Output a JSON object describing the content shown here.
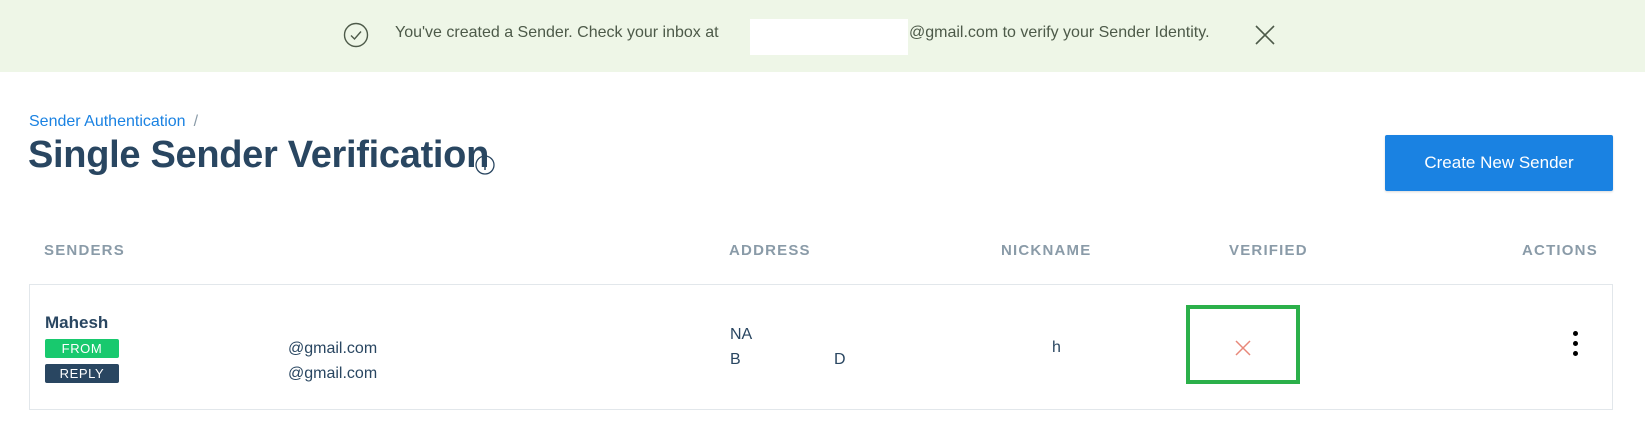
{
  "banner": {
    "message_part1": "You've created a Sender. Check your inbox at",
    "message_part2": "@gmail.com to verify your Sender Identity.",
    "icon": "check-circle-icon",
    "close_icon": "close-icon",
    "background": "#eef6e7"
  },
  "breadcrumb": {
    "parent": "Sender Authentication",
    "separator": "/"
  },
  "page": {
    "title": "Single Sender Verification",
    "info_icon": "info-icon"
  },
  "create_button": {
    "label": "Create New Sender",
    "color": "#1a82e2"
  },
  "table": {
    "headers": {
      "senders": "SENDERS",
      "address": "ADDRESS",
      "nickname": "NICKNAME",
      "verified": "VERIFIED",
      "actions": "ACTIONS"
    },
    "rows": [
      {
        "name": "Mahesh",
        "from_badge": "FROM",
        "reply_badge": "REPLY",
        "from_email": "@gmail.com",
        "reply_email": "@gmail.com",
        "address_line1": "NA",
        "address_line2_a": "B",
        "address_line2_b": "D",
        "nickname": "h",
        "verified": false,
        "verified_icon": "x-icon",
        "actions_icon": "kebab-menu-icon"
      }
    ]
  },
  "colors": {
    "title": "#294661",
    "from_badge": "#18c96e",
    "reply_badge": "#294661",
    "highlight_box": "#2bb04a",
    "unverified_x": "#e8887a"
  }
}
